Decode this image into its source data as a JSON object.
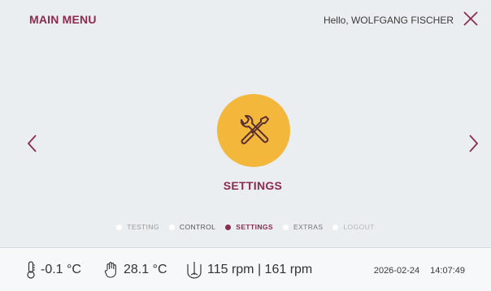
{
  "header": {
    "title": "MAIN MENU",
    "greeting": "Hello, WOLFGANG FISCHER",
    "close_icon": "close-icon"
  },
  "navigation": {
    "prev_icon": "chevron-left-icon",
    "next_icon": "chevron-right-icon"
  },
  "current_item": {
    "label": "SETTINGS",
    "icon": "tools-icon",
    "color": "#f3b73c"
  },
  "pager": {
    "items": [
      {
        "label": "TESTING",
        "active": false
      },
      {
        "label": "CONTROL",
        "active": false
      },
      {
        "label": "SETTINGS",
        "active": true
      },
      {
        "label": "EXTRAS",
        "active": false
      },
      {
        "label": "LOGOUT",
        "active": false
      }
    ]
  },
  "status": {
    "temperature_1": "-0.1 °C",
    "temperature_2": "28.1 °C",
    "speed": "115 rpm | 161 rpm",
    "date": "2026-02-24",
    "time": "14:07:49"
  },
  "colors": {
    "accent": "#8c2a4f",
    "tile": "#f3b73c",
    "background": "#ebeef1"
  }
}
